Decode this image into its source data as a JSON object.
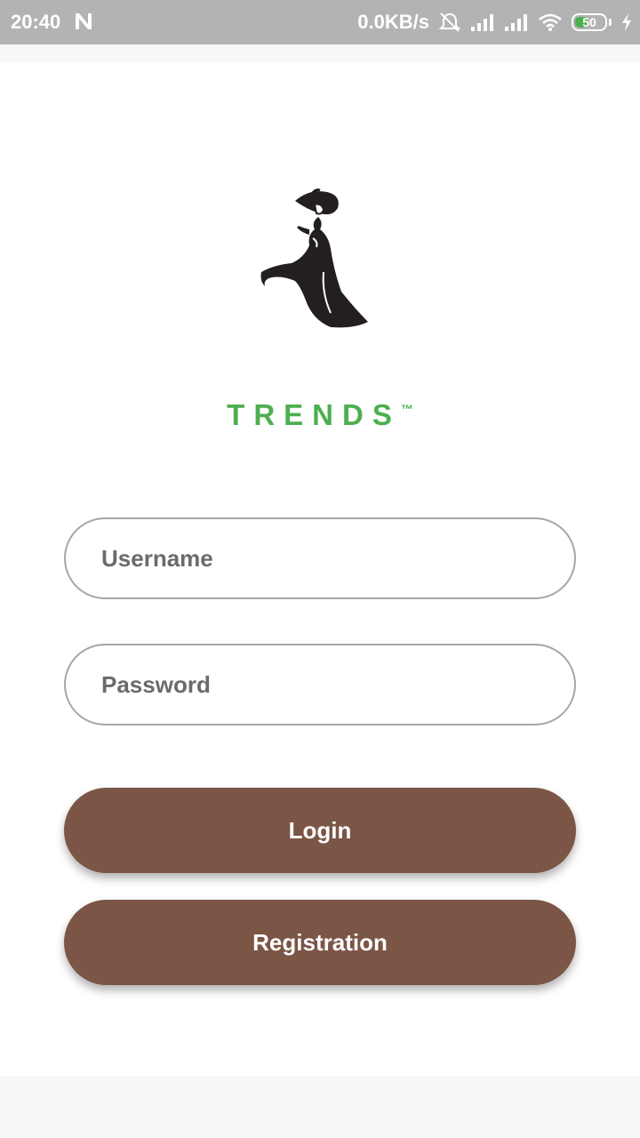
{
  "status_bar": {
    "time": "20:40",
    "net_speed": "0.0KB/s",
    "battery_level": "50",
    "battery_fraction": 0.5,
    "icons": [
      "n-notification-icon",
      "alarm-off-icon",
      "signal-icon",
      "signal-icon",
      "wifi-icon",
      "battery-icon",
      "charging-icon"
    ]
  },
  "brand": {
    "name": "TRENDS",
    "trademark": "™",
    "color": "#4caf50",
    "logo_icon": "lady-dress-logo"
  },
  "form": {
    "username_placeholder": "Username",
    "password_placeholder": "Password",
    "username_value": "",
    "password_value": ""
  },
  "buttons": {
    "login_label": "Login",
    "registration_label": "Registration",
    "color": "#7b5546"
  }
}
